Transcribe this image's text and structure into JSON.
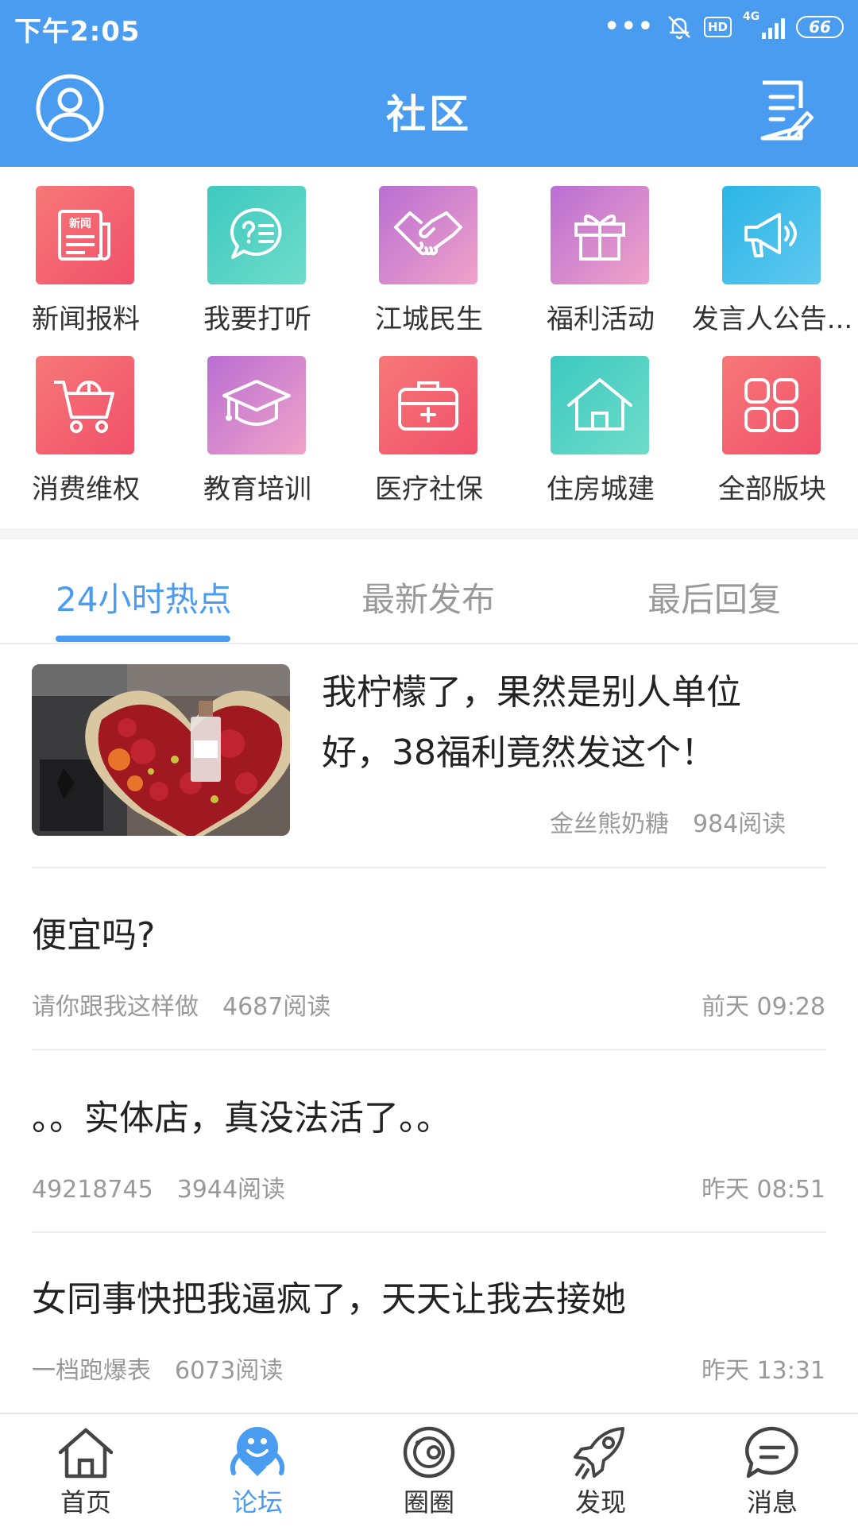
{
  "status_bar": {
    "time": "下午2:05",
    "network": "4G",
    "hd": "HD",
    "battery": "66"
  },
  "header": {
    "title": "社区",
    "avatar_icon": "user-avatar-icon",
    "compose_icon": "edit-note-icon"
  },
  "categories": [
    {
      "label": "新闻报料",
      "icon": "newspaper-icon",
      "badge": "新闻",
      "color": "red"
    },
    {
      "label": "我要打听",
      "icon": "question-chat-icon",
      "color": "teal"
    },
    {
      "label": "江城民生",
      "icon": "handshake-icon",
      "color": "purple"
    },
    {
      "label": "福利活动",
      "icon": "gift-icon",
      "color": "purple"
    },
    {
      "label": "发言人公告...",
      "icon": "megaphone-icon",
      "color": "blue"
    },
    {
      "label": "消费维权",
      "icon": "shopping-cart-icon",
      "color": "red"
    },
    {
      "label": "教育培训",
      "icon": "graduation-cap-icon",
      "color": "purple"
    },
    {
      "label": "医疗社保",
      "icon": "medical-kit-icon",
      "color": "red"
    },
    {
      "label": "住房城建",
      "icon": "house-icon",
      "color": "teal"
    },
    {
      "label": "全部版块",
      "icon": "grid-icon",
      "color": "red"
    }
  ],
  "tabs": [
    {
      "label": "24小时热点",
      "active": true
    },
    {
      "label": "最新发布",
      "active": false
    },
    {
      "label": "最后回复",
      "active": false
    }
  ],
  "posts": [
    {
      "title": "我柠檬了，果然是别人单位好，38福利竟然发这个！",
      "author": "金丝熊奶糖",
      "reads": "984阅读",
      "time": "",
      "has_image": true
    },
    {
      "title": "便宜吗?",
      "author": "请你跟我这样做",
      "reads": "4687阅读",
      "time": "前天 09:28",
      "has_image": false
    },
    {
      "title": "。。实体店，真没法活了。。",
      "author": "49218745",
      "reads": "3944阅读",
      "time": "昨天 08:51",
      "has_image": false
    },
    {
      "title": "女同事快把我逼疯了，天天让我去接她",
      "author": "一档跑爆表",
      "reads": "6073阅读",
      "time": "昨天 13:31",
      "has_image": false
    }
  ],
  "bottom_nav": [
    {
      "label": "首页",
      "icon": "home-icon",
      "active": false
    },
    {
      "label": "论坛",
      "icon": "forum-mascot-icon",
      "active": true
    },
    {
      "label": "圈圈",
      "icon": "planet-icon",
      "active": false
    },
    {
      "label": "发现",
      "icon": "rocket-icon",
      "active": false
    },
    {
      "label": "消息",
      "icon": "message-bubble-icon",
      "active": false
    }
  ],
  "colors": {
    "primary": "#4a9cf0",
    "text": "#222222",
    "muted": "#999999"
  }
}
